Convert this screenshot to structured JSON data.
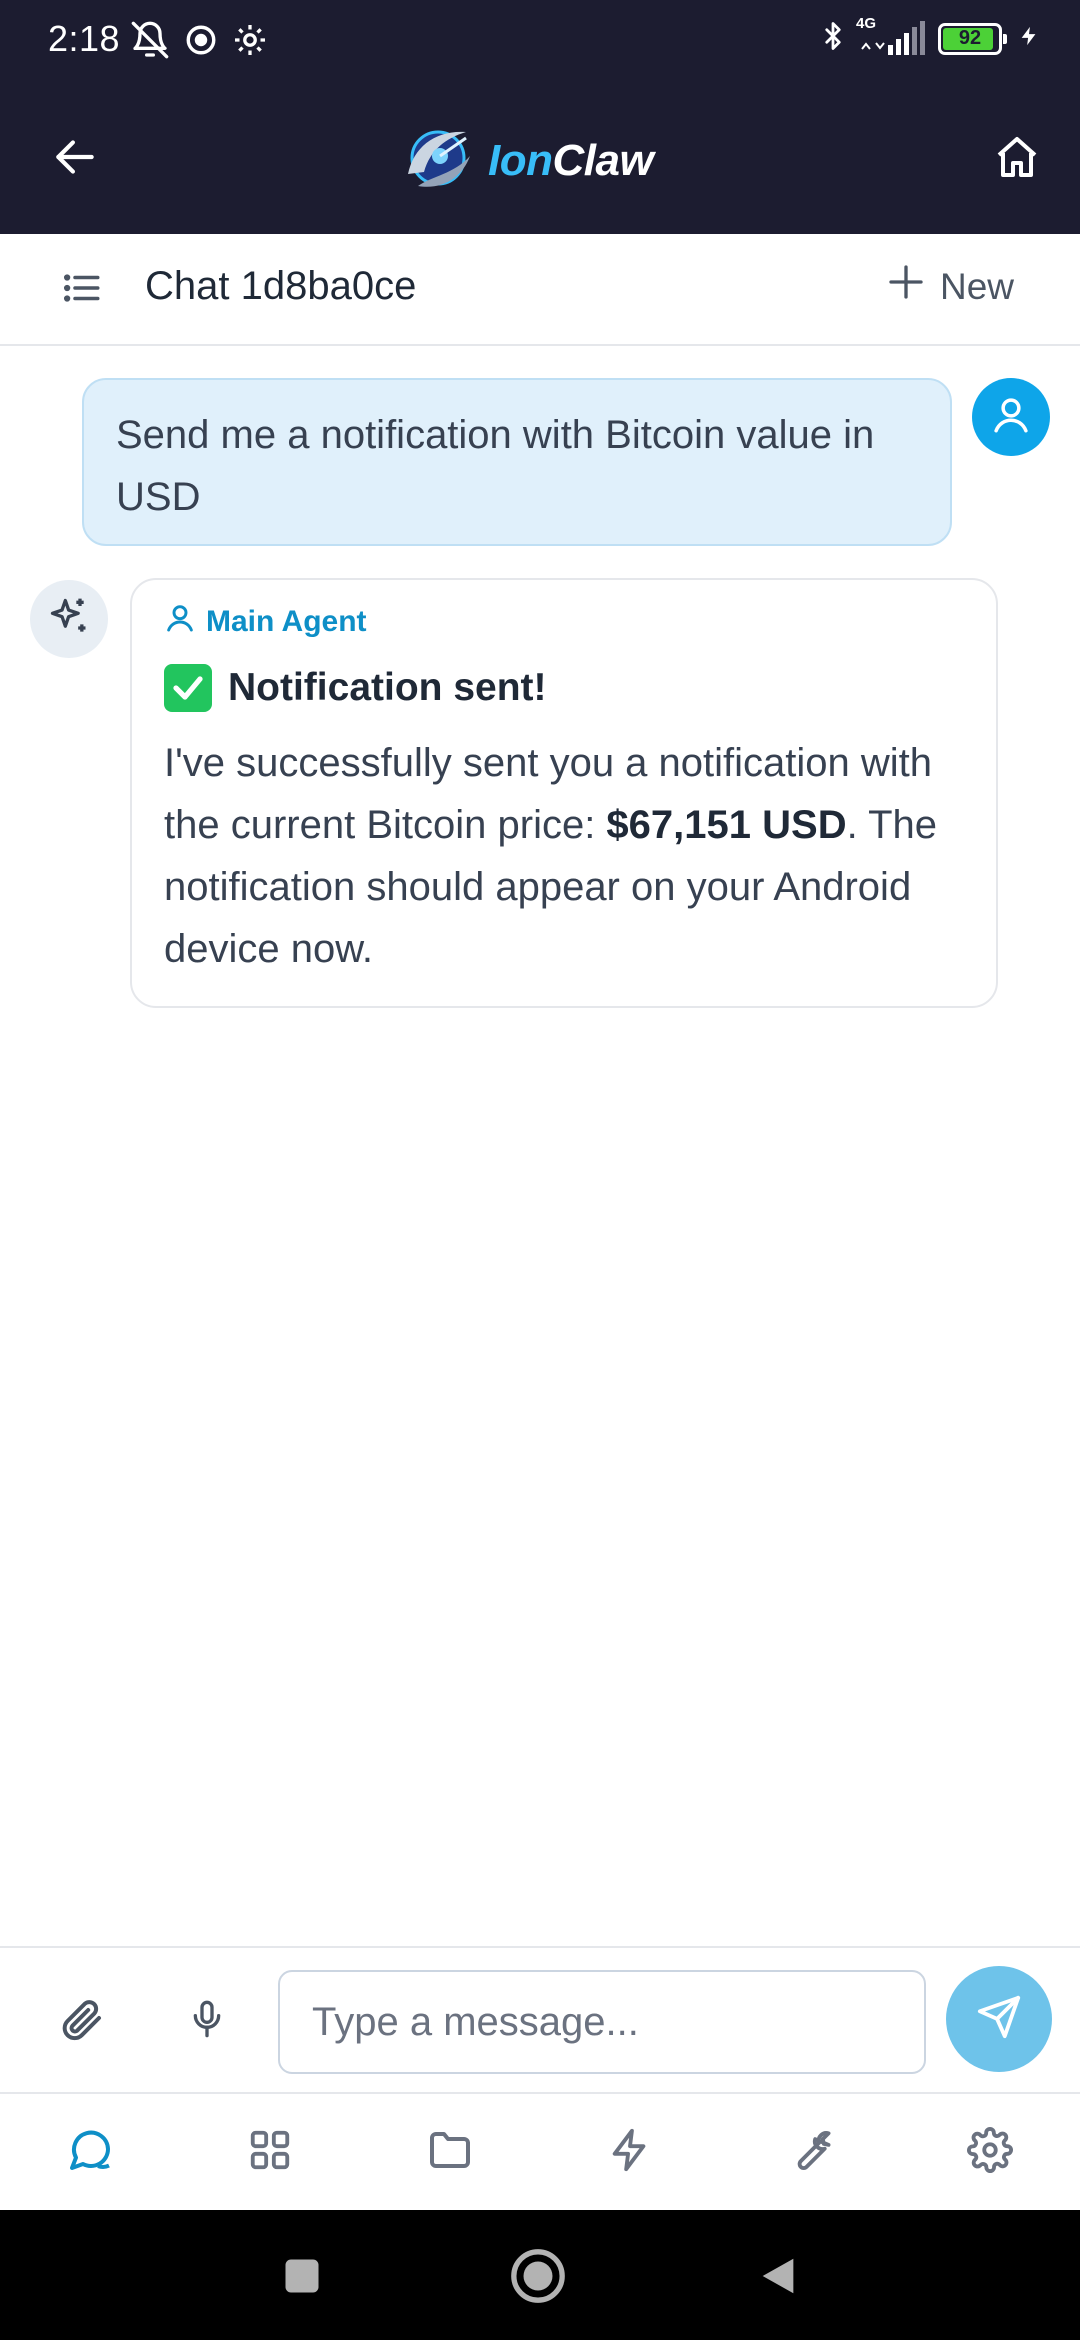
{
  "status_bar": {
    "time": "2:18",
    "network": "4G",
    "battery_level": "92",
    "battery_fraction": 0.92
  },
  "header": {
    "logo_part1": "Ion",
    "logo_part2": "Claw"
  },
  "chat_bar": {
    "title": "Chat 1d8ba0ce",
    "new_label": "New"
  },
  "messages": {
    "user": {
      "text": "Send me a notification with Bitcoin value in USD"
    },
    "agent": {
      "name": "Main Agent",
      "heading": "Notification sent!",
      "body_part1": "I've successfully sent you a notification with the current Bitcoin price: ",
      "body_bold": "$67,151 USD",
      "body_part2": ". The notification should appear on your Android device now."
    }
  },
  "composer": {
    "placeholder": "Type a message..."
  },
  "colors": {
    "header_bg": "#1c1c30",
    "accent": "#0ea5e9",
    "user_bubble": "#e0f0fb",
    "send_button": "#6ec3ea",
    "active_nav": "#0e8fc7",
    "inactive_nav": "#6b7280"
  },
  "icons": {
    "bottom_nav": [
      "chat-icon",
      "grid-icon",
      "folder-icon",
      "lightning-icon",
      "wrench-icon",
      "settings-icon"
    ]
  }
}
